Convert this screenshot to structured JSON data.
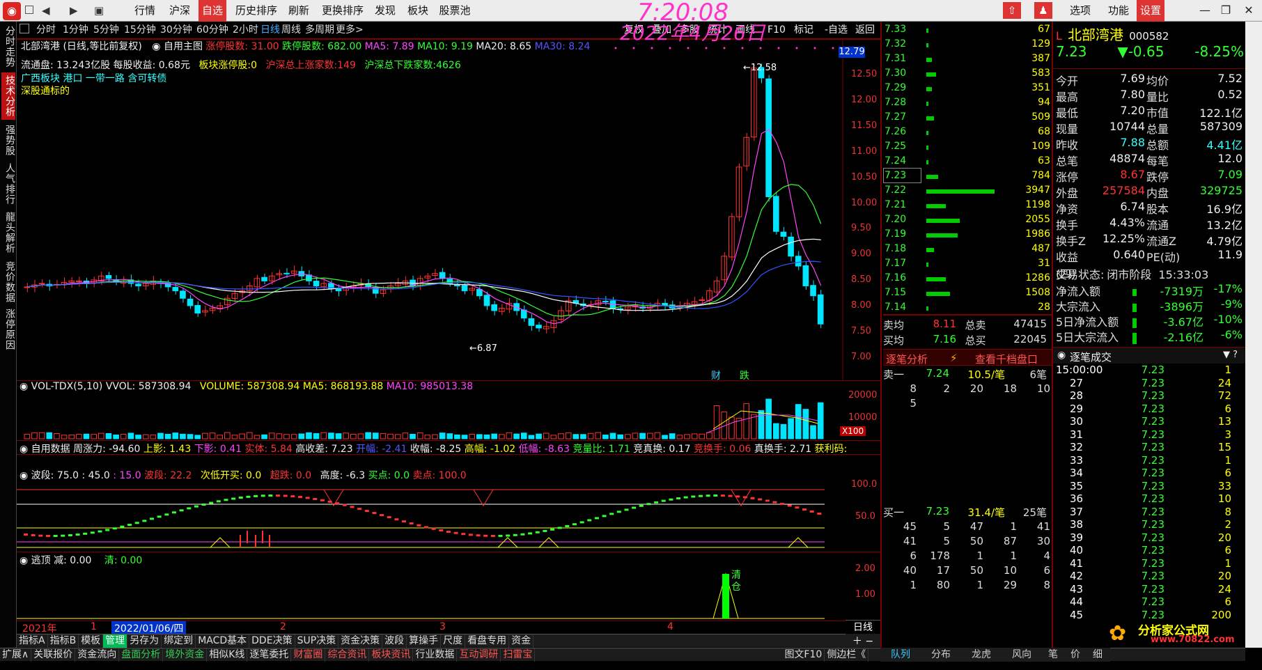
{
  "menu": [
    "行情",
    "沪深",
    "自选",
    "历史排序",
    "刷新",
    "更换排序",
    "发现",
    "板块",
    "股票池"
  ],
  "topright": [
    "选项",
    "功能",
    "设置"
  ],
  "clock": {
    "time": "7:20:08",
    "date": "2022年4月26日"
  },
  "sidetabs": [
    "分时走势",
    "技术分析",
    "强势股",
    "人气排行",
    "龍头解析",
    "竞价数据",
    "涨停原因"
  ],
  "periods": [
    "分时",
    "1分钟",
    "5分钟",
    "15分钟",
    "30分钟",
    "60分钟",
    "2小时",
    "日线",
    "周线",
    "多周期",
    "更多>"
  ],
  "toolbar": [
    "复权",
    "叠加",
    "多股",
    "统计",
    "画线",
    "F10",
    "标记",
    "-自选",
    "返回"
  ],
  "info": {
    "line1": [
      "北部湾港 (日线,等比前复权)",
      "自用主图",
      "涨停股数: 31.00",
      "跌停股数: 682.00",
      "MA5: 7.89",
      "MA10: 9.19",
      "MA20: 8.65",
      "MA30: 8.24"
    ],
    "line2": [
      "流通盘: 13.243亿股 每股收益: 0.68元",
      "板块涨停股:0",
      "沪深总上涨家数:149",
      "沪深总下跌家数:4626"
    ],
    "line3": "广西板块 港口 一带一路 含可转债",
    "line4": "深股通标的"
  },
  "price_axis": [
    "12.50",
    "12.00",
    "11.50",
    "11.00",
    "10.50",
    "10.00",
    "9.50",
    "9.00",
    "8.50",
    "8.00",
    "7.50",
    "7.00"
  ],
  "price_tag": "12.79",
  "hi_label": "12.58",
  "lo_label": "6.87",
  "markers": [
    "财",
    "跌"
  ],
  "vol": {
    "label": "VOL-TDX(5,10)",
    "vvol": "VVOL: 587308.94",
    "volume": "VOLUME: 587308.94",
    "ma5": "MA5: 868193.88",
    "ma10": "MA10: 985013.38",
    "axis": [
      "20000",
      "10000"
    ],
    "unit": "X100"
  },
  "custom": [
    "自用数据",
    "周涨力: -94.60",
    "上影: 1.43",
    "下影: 0.41",
    "实体: 5.84",
    "高收差: 7.23",
    "开幅: -2.41",
    "收幅: -8.25",
    "高幅: -1.02",
    "低幅: -8.63",
    "竞量比: 1.71",
    "竞真换: 0.17",
    "竞换手: 0.06",
    "真换手: 2.71",
    "获利码:"
  ],
  "wave": {
    "label": "波段",
    "v1": ": 75.0 : 45.0",
    "v2": ": 15.0",
    "wave": "波段: 22.2",
    "cikai": "次低开买: 0.0",
    "chaodie": "超跌: 0.0",
    "gaodu": "高度: -6.3",
    "buy": "买点: 0.0",
    "sell": "卖点: 100.0",
    "axis": [
      "100.0",
      "50.0"
    ]
  },
  "escape": {
    "label": "逃顶",
    "jian": "减: 0.00",
    "qing": "清: 0.00",
    "axis": [
      "2.00",
      "1.00"
    ],
    "mark": "清仓"
  },
  "timeline": {
    "year": "2021年",
    "m1": "1",
    "date": "2022/01/06/四",
    "m2": "2",
    "m3": "3",
    "m4": "4",
    "period": "日线"
  },
  "bottom1": [
    "指标A",
    "指标B",
    "模板",
    "管理",
    "另存为",
    "绑定到",
    "MACD基本",
    "DDE决策",
    "SUP决策",
    "资金决策",
    "波段",
    "算操手",
    "尺度",
    "看盘专用",
    "资金"
  ],
  "bottom2": [
    "扩展∧",
    "关联报价",
    "资金流向",
    "盘面分析",
    "境外资金",
    "相似K线",
    "逐笔委托",
    "财富圈",
    "综合资讯",
    "板块资讯",
    "行业数据",
    "互动调研",
    "扫雷宝",
    "图文F10",
    "侧边栏《"
  ],
  "bottom_right": [
    "队列",
    "分布",
    "龙虎",
    "风向",
    "笔",
    "价",
    "细"
  ],
  "book_prices": [
    "7.33",
    "7.32",
    "7.31",
    "7.30",
    "7.29",
    "7.28",
    "7.27",
    "7.26",
    "7.25",
    "7.24",
    "7.23",
    "7.22",
    "7.21",
    "7.20",
    "7.19",
    "7.18",
    "7.17",
    "7.16",
    "7.15",
    "7.14"
  ],
  "book_vols": [
    "67",
    "129",
    "387",
    "583",
    "351",
    "94",
    "509",
    "68",
    "109",
    "63",
    "784",
    "3947",
    "1198",
    "2055",
    "1986",
    "487",
    "31",
    "1286",
    "1508",
    "28"
  ],
  "book_bars": [
    0.005,
    0.01,
    0.03,
    0.05,
    0.03,
    0.007,
    0.04,
    0.005,
    0.008,
    0.005,
    0.06,
    0.35,
    0.1,
    0.17,
    0.16,
    0.04,
    0.003,
    0.1,
    0.12,
    0.002
  ],
  "avg": {
    "sell_l": "卖均",
    "sell_v": "8.11",
    "sell_l2": "总卖",
    "sell_v2": "47415",
    "buy_l": "买均",
    "buy_v": "7.16",
    "buy_l2": "总买",
    "buy_v2": "22045"
  },
  "analysis": {
    "a": "逐笔分析",
    "b": "查看千档盘口"
  },
  "sell1": {
    "l": "卖一",
    "p": "7.24",
    "v": "10.5/笔",
    "n": "6笔",
    "q": [
      [
        "8",
        "2",
        "20",
        "18",
        "10"
      ],
      [
        "5",
        "",
        "",
        "",
        ""
      ]
    ]
  },
  "buy1": {
    "l": "买一",
    "p": "7.23",
    "v": "31.4/笔",
    "n": "25笔",
    "q": [
      [
        "45",
        "5",
        "47",
        "1",
        "41"
      ],
      [
        "41",
        "5",
        "50",
        "87",
        "30"
      ],
      [
        "6",
        "178",
        "1",
        "1",
        "4"
      ],
      [
        "40",
        "17",
        "50",
        "10",
        "6"
      ],
      [
        "1",
        "80",
        "1",
        "29",
        "8"
      ]
    ]
  },
  "stock": {
    "flag": "L",
    "name": "北部湾港",
    "code": "000582",
    "price": "7.23",
    "chg": "▼-0.65",
    "pct": "-8.25%"
  },
  "quote": [
    [
      "今开",
      "7.69",
      "均价",
      "7.52"
    ],
    [
      "最高",
      "7.80",
      "量比",
      "0.52"
    ],
    [
      "最低",
      "7.20",
      "市值",
      "122.1亿"
    ],
    [
      "现量",
      "10744",
      "总量",
      "587309"
    ],
    [
      "昨收",
      "7.88",
      "总额",
      "4.41亿"
    ],
    [
      "总笔",
      "48874",
      "每笔",
      "12.0"
    ],
    [
      "涨停",
      "8.67",
      "跌停",
      "7.09"
    ],
    [
      "外盘",
      "257584",
      "内盘",
      "329725"
    ],
    [
      "净资",
      "6.74",
      "股本",
      "16.9亿"
    ],
    [
      "换手",
      "4.43%",
      "流通",
      "13.2亿"
    ],
    [
      "换手Z",
      "12.25%",
      "流通Z",
      "4.79亿"
    ],
    [
      "收益(四)",
      "0.640",
      "PE(动)",
      "11.9"
    ]
  ],
  "state": {
    "l": "交易状态:",
    "v": "闭市阶段",
    "t": "15:33:03"
  },
  "flows": [
    [
      "净流入额",
      "-7319万",
      "-17%"
    ],
    [
      "大宗流入",
      "-3896万",
      "-9%"
    ],
    [
      "5日净流入额",
      "-3.67亿",
      "-10%"
    ],
    [
      "5日大宗流入",
      "-2.16亿",
      "-6%"
    ]
  ],
  "ticks_title": "逐笔成交",
  "ticks": [
    [
      "15:00:00",
      "7.23",
      "1"
    ],
    [
      "27",
      "7.23",
      "24"
    ],
    [
      "28",
      "7.23",
      "72"
    ],
    [
      "29",
      "7.23",
      "6"
    ],
    [
      "30",
      "7.23",
      "13"
    ],
    [
      "31",
      "7.23",
      "3"
    ],
    [
      "32",
      "7.23",
      "15"
    ],
    [
      "33",
      "7.23",
      "1"
    ],
    [
      "34",
      "7.23",
      "6"
    ],
    [
      "35",
      "7.23",
      "33"
    ],
    [
      "36",
      "7.23",
      "10"
    ],
    [
      "37",
      "7.23",
      "8"
    ],
    [
      "38",
      "7.23",
      "2"
    ],
    [
      "39",
      "7.23",
      "20"
    ],
    [
      "40",
      "7.23",
      "6"
    ],
    [
      "41",
      "7.23",
      "1"
    ],
    [
      "42",
      "7.23",
      "20"
    ],
    [
      "43",
      "7.23",
      "24"
    ],
    [
      "44",
      "7.23",
      "6"
    ],
    [
      "45",
      "7.23",
      "200"
    ]
  ],
  "brand": {
    "name": "分析家公式网",
    "url": "www.70822.com"
  },
  "colors": {
    "up": "#ff3333",
    "down": "#00e5ff",
    "accent": "#d33333",
    "text_yellow": "#ffff00"
  }
}
